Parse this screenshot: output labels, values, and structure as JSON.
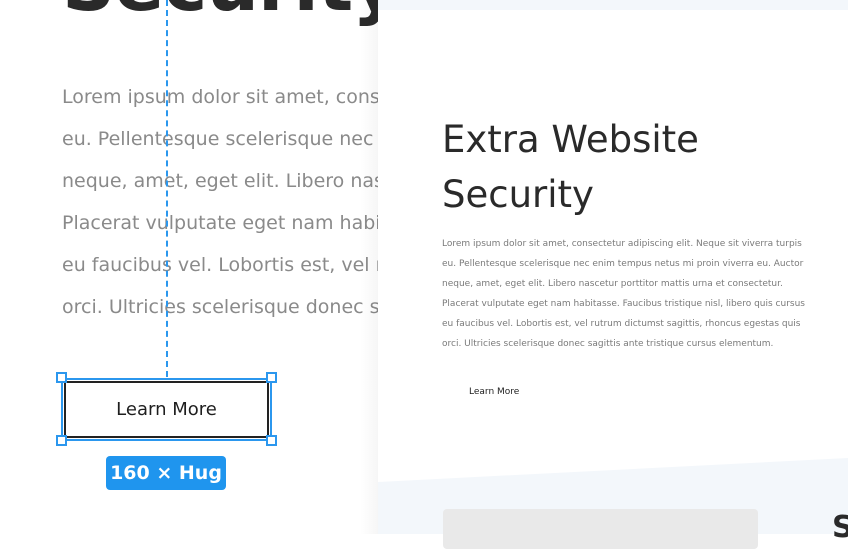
{
  "canvas": {
    "heading": "Security",
    "body_lines": [
      "Lorem ipsum dolor sit amet, consectetur",
      "eu. Pellentesque scelerisque nec enim",
      "neque, amet, eget elit. Libero nascetur",
      "Placerat vulputate eget nam habitasse.",
      "eu faucibus vel. Lobortis est, vel rutrum",
      "orci. Ultricies scelerisque donec sagittis"
    ],
    "button_label": "Learn More",
    "size_badge": "160 × Hug",
    "selection_color": "#2b97ee"
  },
  "preview": {
    "title_lines": [
      "Extra Website",
      "Security"
    ],
    "body_lines": [
      "Lorem ipsum dolor sit amet, consectetur adipiscing elit. Neque sit viverra turpis",
      "eu. Pellentesque scelerisque nec enim tempus netus mi proin viverra eu. Auctor",
      "neque, amet, eget elit. Libero nascetur porttitor mattis urna et consectetur.",
      "Placerat vulputate eget nam habitasse. Faucibus tristique nisl, libero quis cursus",
      "eu faucibus vel. Lobortis est, vel rutrum dictumst sagittis, rhoncus egestas quis",
      "orci. Ultricies scelerisque donec sagittis ante tristique cursus elementum."
    ],
    "button_label": "Learn More",
    "edge_glyph": "S",
    "bottom_bg": "#f3f7fb"
  }
}
